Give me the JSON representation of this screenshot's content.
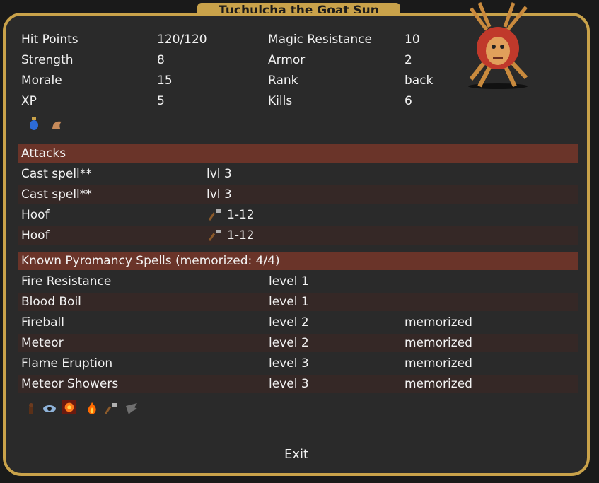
{
  "window": {
    "title": "Tuchulcha the Goat Sun"
  },
  "stats": {
    "left": [
      {
        "label": "Hit Points",
        "value": "120/120"
      },
      {
        "label": "Strength",
        "value": "8"
      },
      {
        "label": "Morale",
        "value": "15"
      },
      {
        "label": "XP",
        "value": "5"
      }
    ],
    "right": [
      {
        "label": "Magic Resistance",
        "value": "10"
      },
      {
        "label": "Armor",
        "value": "2"
      },
      {
        "label": "Rank",
        "value": "back"
      },
      {
        "label": "Kills",
        "value": "6"
      }
    ]
  },
  "inventory_icons": [
    "potion-icon",
    "horn-icon"
  ],
  "attacks": {
    "header": "Attacks",
    "rows": [
      {
        "name": "Cast spell**",
        "value": "lvl 3",
        "icon": ""
      },
      {
        "name": "Cast spell**",
        "value": "lvl 3",
        "icon": ""
      },
      {
        "name": "Hoof",
        "value": "1-12",
        "icon": "hammer-icon"
      },
      {
        "name": "Hoof",
        "value": "1-12",
        "icon": "hammer-icon"
      }
    ]
  },
  "spells": {
    "header": "Known Pyromancy Spells (memorized: 4/4)",
    "rows": [
      {
        "name": "Fire Resistance",
        "level": "level 1",
        "status": ""
      },
      {
        "name": "Blood Boil",
        "level": "level 1",
        "status": ""
      },
      {
        "name": "Fireball",
        "level": "level 2",
        "status": "memorized"
      },
      {
        "name": "Meteor",
        "level": "level 2",
        "status": "memorized"
      },
      {
        "name": "Flame Eruption",
        "level": "level 3",
        "status": "memorized"
      },
      {
        "name": "Meteor Showers",
        "level": "level 3",
        "status": "memorized"
      }
    ]
  },
  "ability_icons": [
    "figure-icon",
    "eye-icon",
    "fire-burst-icon",
    "flame-icon",
    "hammer-icon",
    "wing-icon"
  ],
  "actions": {
    "exit_label": "Exit"
  },
  "colors": {
    "frame_gold": "#c9a24a",
    "header_band": "#6a3429",
    "row_band": "#352826",
    "background": "#2a2a2a"
  }
}
